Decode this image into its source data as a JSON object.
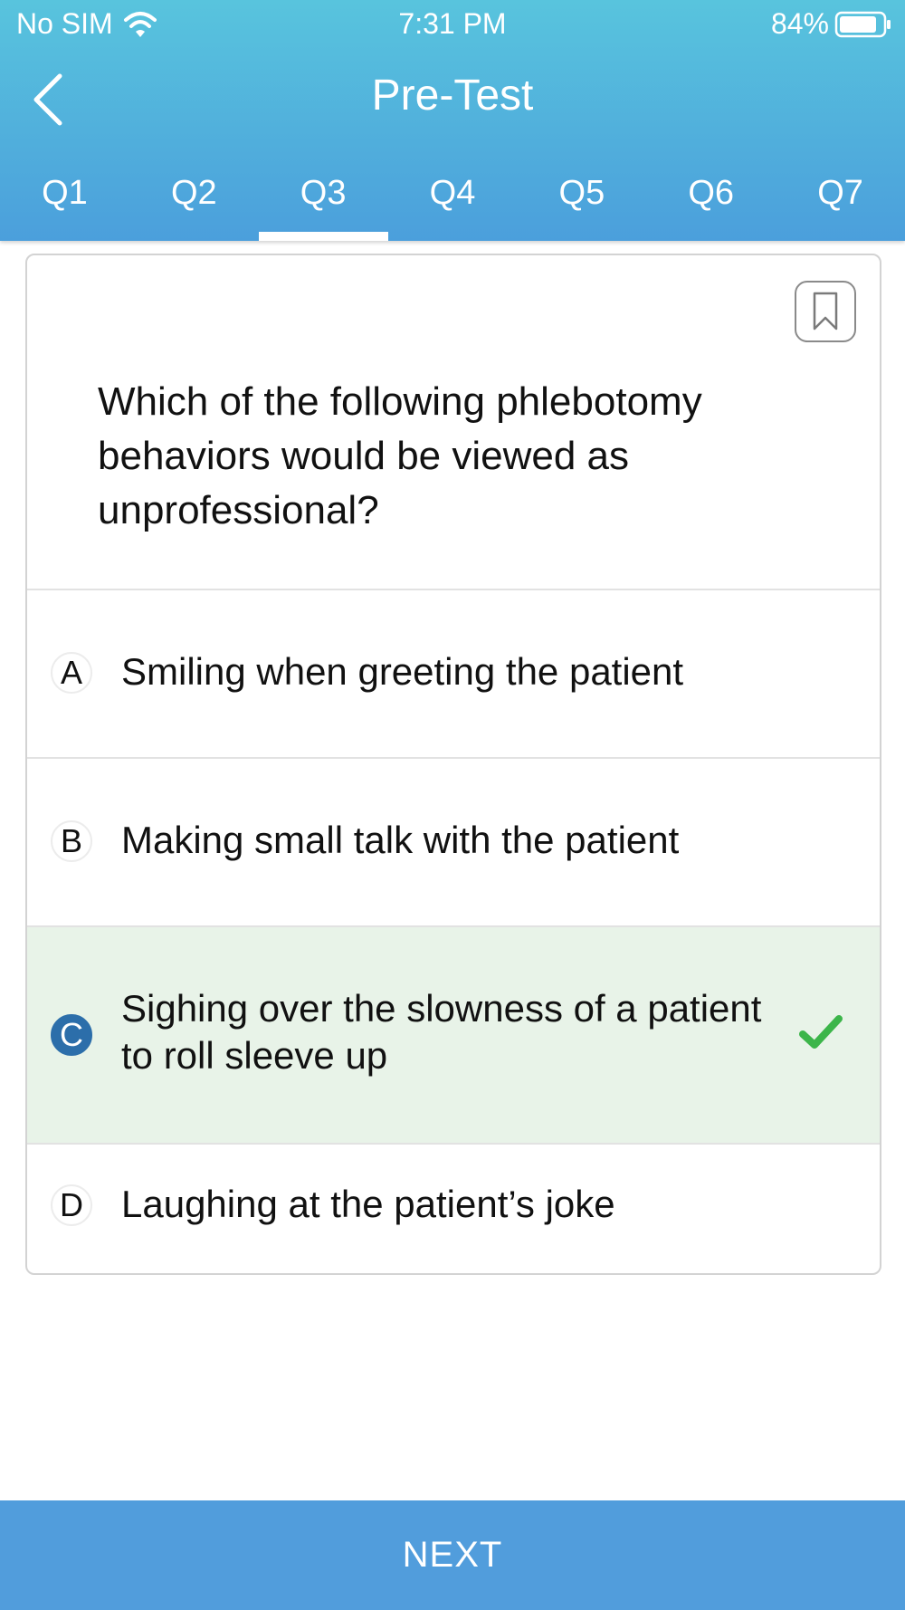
{
  "status_bar": {
    "carrier": "No SIM",
    "time": "7:31 PM",
    "battery": "84%"
  },
  "nav": {
    "title": "Pre-Test"
  },
  "tabs": [
    {
      "label": "Q1"
    },
    {
      "label": "Q2"
    },
    {
      "label": "Q3"
    },
    {
      "label": "Q4"
    },
    {
      "label": "Q5"
    },
    {
      "label": "Q6"
    },
    {
      "label": "Q7"
    }
  ],
  "active_tab": "Q3",
  "question": {
    "text": "Which of the following phlebotomy behaviors would be viewed as unprofessional?",
    "options": [
      {
        "letter": "A",
        "text": "Smiling when greeting the patient"
      },
      {
        "letter": "B",
        "text": "Making small talk with the patient"
      },
      {
        "letter": "C",
        "text": "Sighing over the slowness of a patient to roll sleeve up"
      },
      {
        "letter": "D",
        "text": "Laughing at the patient’s joke"
      }
    ],
    "selected": "C",
    "correct": "C"
  },
  "footer": {
    "next_label": "NEXT"
  },
  "colors": {
    "header_gradient_top": "#58c4dd",
    "header_gradient_bottom": "#4b9fdc",
    "selected_letter": "#2c6eaa",
    "correct_bg": "#e8f3e8",
    "check_green": "#3cb54a",
    "next_button": "#519ddc"
  },
  "icons": {
    "wifi": "wifi-icon",
    "battery": "battery-icon",
    "back": "chevron-left-icon",
    "bookmark": "bookmark-icon",
    "correct": "checkmark-icon"
  }
}
